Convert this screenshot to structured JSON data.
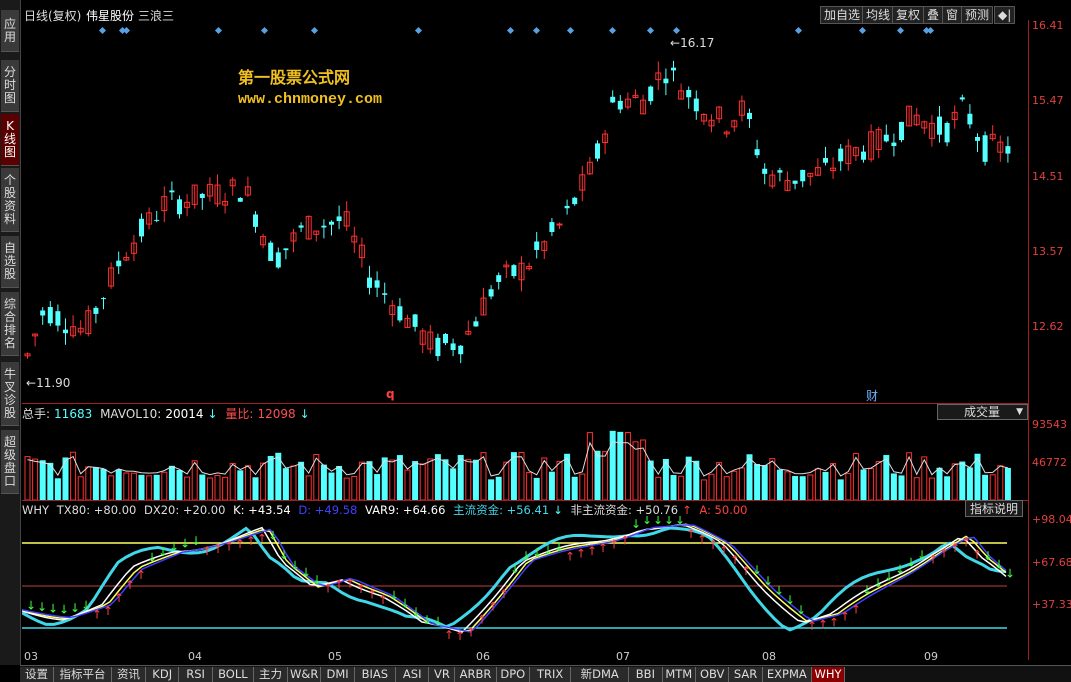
{
  "window": {
    "title_period": "日线(复权)",
    "title_stock": "伟星股份",
    "title_wave": "三浪三"
  },
  "toolbar": {
    "add_watch": "加自选",
    "ma": "均线",
    "adjust": "复权",
    "overlay": "叠",
    "window": "窗",
    "forecast": "预测",
    "exit": "◆|"
  },
  "sidebar": {
    "items": [
      {
        "label": "应用"
      },
      {
        "label": "分时图"
      },
      {
        "label": "K线图"
      },
      {
        "label": "个股资料"
      },
      {
        "label": "自选股"
      },
      {
        "label": "综合排名"
      },
      {
        "label": "牛叉诊股"
      },
      {
        "label": "超级盘口"
      }
    ]
  },
  "watermark": {
    "name": "第一股票公式网",
    "url": "www.chnmoney.com"
  },
  "price_axis": {
    "labels": [
      "16.41",
      "15.47",
      "14.51",
      "13.57",
      "12.62"
    ]
  },
  "annotations": {
    "high": "16.17",
    "low": "11.90",
    "marker_q": "q",
    "marker_cai": "财"
  },
  "volume_panel": {
    "total_label": "总手:",
    "total_value": "11683",
    "mavol_label": "MAVOL10:",
    "mavol_value": "20014",
    "ratio_label": "量比:",
    "ratio_value": "12098",
    "select_value": "成交量",
    "axis": [
      "93543",
      "46772"
    ]
  },
  "indicator_panel": {
    "name": "WHY",
    "tx80": "TX80: +80.00",
    "dx20": "DX20: +20.00",
    "k": "K: +43.54",
    "d": "D: +49.58",
    "var9": "VAR9: +64.66",
    "main_fund": "主流资金: +56.41",
    "non_main_fund": "非主流资金: +50.76",
    "a": "A: 50.00",
    "help_button": "指标说明",
    "axis": [
      "+98.04",
      "+67.68",
      "+37.33"
    ]
  },
  "date_axis": {
    "labels": [
      "03",
      "04",
      "05",
      "06",
      "07",
      "08",
      "09"
    ]
  },
  "bottom_tabs": [
    {
      "label": "设置"
    },
    {
      "label": "指标平台"
    },
    {
      "label": "资讯"
    },
    {
      "label": "KDJ"
    },
    {
      "label": "RSI"
    },
    {
      "label": "BOLL"
    },
    {
      "label": "主力"
    },
    {
      "label": "W&R"
    },
    {
      "label": "DMI"
    },
    {
      "label": "BIAS"
    },
    {
      "label": "ASI"
    },
    {
      "label": "VR"
    },
    {
      "label": "ARBR"
    },
    {
      "label": "DPO"
    },
    {
      "label": "TRIX"
    },
    {
      "label": "新DMA"
    },
    {
      "label": "BBI"
    },
    {
      "label": "MTM"
    },
    {
      "label": "OBV"
    },
    {
      "label": "SAR"
    },
    {
      "label": "EXPMA"
    },
    {
      "label": "WHY"
    }
  ],
  "colors": {
    "up": "#ff3030",
    "down": "#54ffff",
    "price_axis": "#e04040",
    "yellow_line": "#ffff60",
    "cyan_line": "#40d8e8",
    "white_line": "#ffffff",
    "green_arrow": "#40ff40",
    "red_arrow": "#ff4040"
  }
}
